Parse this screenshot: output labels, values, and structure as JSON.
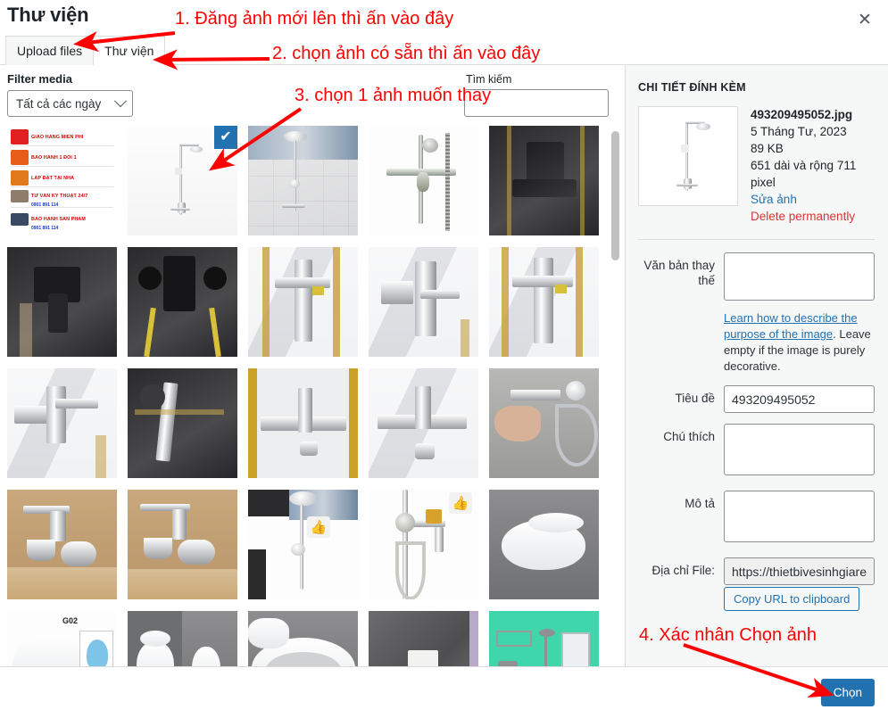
{
  "window": {
    "title": "Thư viện",
    "close_icon": "close-icon",
    "close_label": "✕"
  },
  "tabs": [
    {
      "id": "upload",
      "label": "Upload files",
      "active": false
    },
    {
      "id": "library",
      "label": "Thư viện",
      "active": true
    }
  ],
  "toolbar": {
    "filter_label": "Filter media",
    "date_filter_value": "Tất cả các ngày",
    "date_filter_options": [
      "Tất cả các ngày"
    ],
    "chevron_icon": "chevron-down-icon",
    "search_label": "Tìm kiếm",
    "search_value": "",
    "search_placeholder": ""
  },
  "grid": {
    "selected_index": 1,
    "check_icon": "checkmark-icon",
    "check_glyph": "✔",
    "scrollbar_thumb_top_pct": 2,
    "items": [
      {
        "name": "promo-banner-thumbnail",
        "style": "p-promo",
        "selected": false,
        "badge": null,
        "overlay_text": [
          {
            "text": "GIAO HÀNG MIỄN PHÍ",
            "sub": ""
          },
          {
            "text": "BẢO HÀNH 1 ĐỔI 1",
            "sub": ""
          },
          {
            "text": "LẮP ĐẶT TẠI NHÀ",
            "sub": ""
          },
          {
            "text": "TƯ VẤN KỸ THUẬT 24/7",
            "sub": "0901 891 114"
          },
          {
            "text": "BẢO HÀNH SẢN PHẨM",
            "sub": "0901 891 114"
          }
        ]
      },
      {
        "name": "shower-column-thumbnail",
        "style": "p-shower-white",
        "selected": true,
        "badge": null
      },
      {
        "name": "shower-set-display-thumbnail",
        "style": "p-tiles",
        "selected": false,
        "badge": null
      },
      {
        "name": "shower-mixer-thumbnail",
        "style": "p-white",
        "selected": false,
        "badge": null
      },
      {
        "name": "black-faucet-thumbnail",
        "style": "p-dark",
        "selected": false,
        "badge": null
      },
      {
        "name": "black-mixer-closeup-thumbnail",
        "style": "p-dark",
        "selected": false,
        "badge": null
      },
      {
        "name": "black-wall-mixer-thumbnail",
        "style": "p-dark",
        "selected": false,
        "badge": null
      },
      {
        "name": "chrome-mixer-marble-thumbnail",
        "style": "p-marble",
        "selected": false,
        "badge": null
      },
      {
        "name": "chrome-mixer-angle-thumbnail",
        "style": "p-marble",
        "selected": false,
        "badge": null
      },
      {
        "name": "chrome-mixer-marble2-thumbnail",
        "style": "p-marble",
        "selected": false,
        "badge": null
      },
      {
        "name": "chrome-bath-mixer-thumbnail",
        "style": "p-marble",
        "selected": false,
        "badge": null
      },
      {
        "name": "faucet-dark-counter-thumbnail",
        "style": "p-dark",
        "selected": false,
        "badge": null
      },
      {
        "name": "bath-spout-gold-frame-thumbnail",
        "style": "p-gold",
        "selected": false,
        "badge": null
      },
      {
        "name": "bath-spout-marble-thumbnail",
        "style": "p-marble",
        "selected": false,
        "badge": null
      },
      {
        "name": "hand-holding-shower-thumbnail",
        "style": "p-hand",
        "selected": false,
        "badge": null
      },
      {
        "name": "chrome-basin-tap-wood-thumbnail",
        "style": "p-cardboard",
        "selected": false,
        "badge": null
      },
      {
        "name": "chrome-basin-tap-wood2-thumbnail",
        "style": "p-cardboard",
        "selected": false,
        "badge": null
      },
      {
        "name": "shower-column-display-thumbnail",
        "style": "p-white",
        "selected": false,
        "badge": "👍"
      },
      {
        "name": "shower-set-wall-thumbnail",
        "style": "p-white",
        "selected": false,
        "badge": "👍"
      },
      {
        "name": "wall-hung-toilet-thumbnail",
        "style": "p-bathgrey",
        "selected": false,
        "badge": null
      },
      {
        "name": "toilet-catalog-g02-thumbnail",
        "style": "p-white",
        "selected": false,
        "badge": null,
        "overlay_label": "G02"
      },
      {
        "name": "toilet-pair-thumbnail",
        "style": "p-bathgrey",
        "selected": false,
        "badge": null
      },
      {
        "name": "toilet-seat-closeup-thumbnail",
        "style": "p-bathgrey",
        "selected": false,
        "badge": null
      },
      {
        "name": "flush-plate-wall-thumbnail",
        "style": "p-concrete",
        "selected": false,
        "badge": null
      },
      {
        "name": "bathroom-accessories-thumbnail",
        "style": "p-mint",
        "selected": false,
        "badge": null
      }
    ]
  },
  "sidebar": {
    "title": "CHI TIẾT ĐÍNH KÈM",
    "attachment": {
      "filename": "493209495052.jpg",
      "date": "5 Tháng Tư, 2023",
      "filesize": "89 KB",
      "dimensions": "651 dài và rộng 711 pixel",
      "edit_link": "Sửa ảnh",
      "delete_link": "Delete permanently",
      "preview_name": "shower-column-preview"
    },
    "fields": {
      "alt_label": "Văn bản thay thế",
      "alt_value": "",
      "alt_hint_link": "Learn how to describe the purpose of the image",
      "alt_hint_rest": ". Leave empty if the image is purely decorative.",
      "title_label": "Tiêu đề",
      "title_value": "493209495052",
      "caption_label": "Chú thích",
      "caption_value": "",
      "description_label": "Mô tả",
      "description_value": "",
      "fileurl_label": "Địa chỉ File:",
      "fileurl_value": "https://thietbivesinhgiare.v",
      "copy_url_label": "Copy URL to clipboard"
    }
  },
  "footer": {
    "primary_button": "Chọn"
  },
  "annotations": [
    {
      "id": "anno1",
      "text": "1. Đăng ảnh mới lên thì ấn vào đây"
    },
    {
      "id": "anno2",
      "text": "2. chọn ảnh có sẵn thì ấn vào đây"
    },
    {
      "id": "anno3",
      "text": "3. chọn 1 ảnh muốn thay"
    },
    {
      "id": "anno4",
      "text": "4. Xác nhân Chọn ảnh"
    }
  ],
  "colors": {
    "accent_blue": "#2271b1",
    "selection_blue": "#4f94d4",
    "danger_red": "#d63638",
    "annotation_red": "#ff0000",
    "panel_bg": "#f6f7f7",
    "border": "#dcdcde"
  }
}
